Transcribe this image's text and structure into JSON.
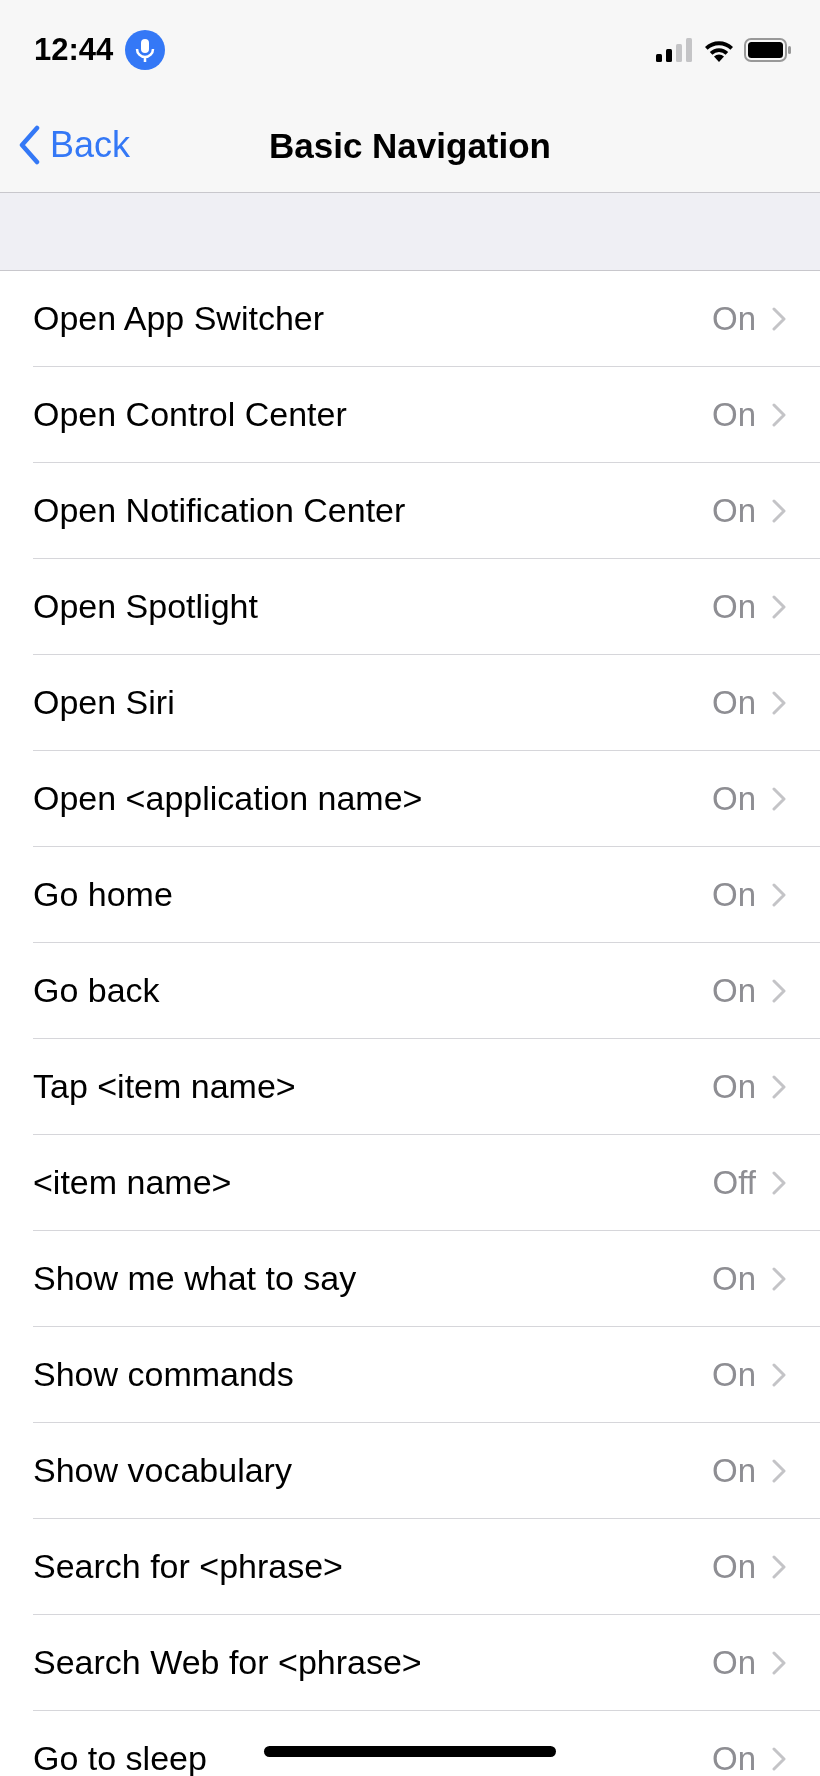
{
  "status_bar": {
    "time": "12:44"
  },
  "nav": {
    "back": "Back",
    "title": "Basic Navigation"
  },
  "rows": [
    {
      "label": "Open App Switcher",
      "value": "On"
    },
    {
      "label": "Open Control Center",
      "value": "On"
    },
    {
      "label": "Open Notification Center",
      "value": "On"
    },
    {
      "label": "Open Spotlight",
      "value": "On"
    },
    {
      "label": "Open Siri",
      "value": "On"
    },
    {
      "label": "Open <application name>",
      "value": "On"
    },
    {
      "label": "Go home",
      "value": "On"
    },
    {
      "label": "Go back",
      "value": "On"
    },
    {
      "label": "Tap <item name>",
      "value": "On"
    },
    {
      "label": "<item name>",
      "value": "Off"
    },
    {
      "label": "Show me what to say",
      "value": "On"
    },
    {
      "label": "Show commands",
      "value": "On"
    },
    {
      "label": "Show vocabulary",
      "value": "On"
    },
    {
      "label": "Search for <phrase>",
      "value": "On"
    },
    {
      "label": "Search Web for <phrase>",
      "value": "On"
    },
    {
      "label": "Go to sleep",
      "value": "On"
    }
  ]
}
